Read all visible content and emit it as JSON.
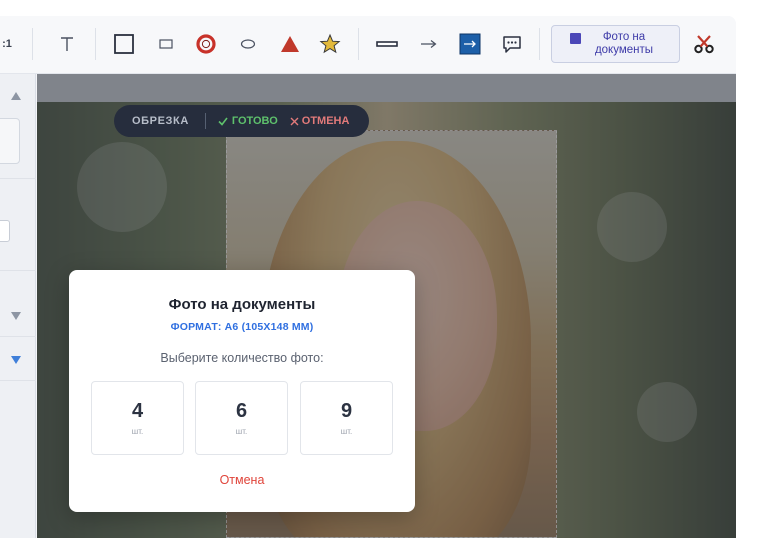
{
  "toolbar": {
    "ratio_label": ":1",
    "doc_button_label": "Фото на документы",
    "colors": {
      "red": "#c8322a",
      "triangle": "#c0392b",
      "star": "#e2b93b",
      "blue": "#1d5fa8"
    },
    "icons": [
      "text-icon",
      "square-icon",
      "rounded-rect-icon",
      "ring-icon",
      "ellipse-icon",
      "triangle-icon",
      "star-icon",
      "line-icon",
      "arrow-icon",
      "highlight-arrow-icon",
      "speech-bubble-icon",
      "document-icon",
      "scissors-icon"
    ]
  },
  "cropbar": {
    "title": "ОБРЕЗКА",
    "done_label": "ГОТОВО",
    "cancel_label": "ОТМЕНА",
    "done_color": "#5ec16c",
    "cancel_color": "#e27a7a"
  },
  "modal": {
    "title": "Фото на документы",
    "format": "ФОРМАТ: А6 (105X148 ММ)",
    "prompt": "Выберите количество фото:",
    "options": [
      {
        "count": "4",
        "unit": "шт."
      },
      {
        "count": "6",
        "unit": "шт."
      },
      {
        "count": "9",
        "unit": "шт."
      }
    ],
    "cancel_label": "Отмена",
    "accent": "#2f6fe0",
    "cancel_color": "#e0443a"
  }
}
